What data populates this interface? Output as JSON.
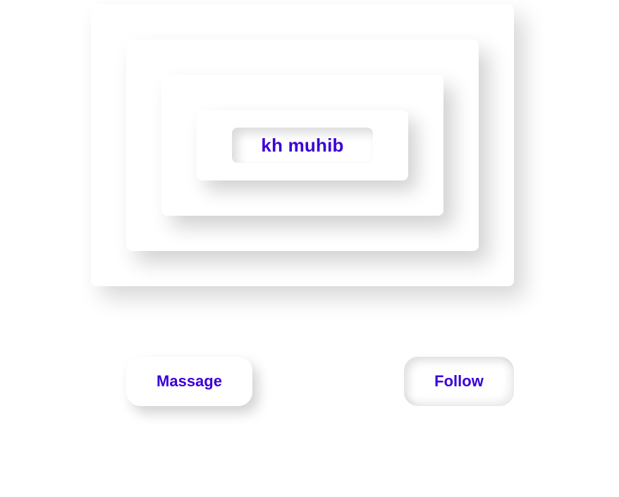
{
  "profile": {
    "name": "kh muhib"
  },
  "actions": {
    "message_label": "Massage",
    "follow_label": "Follow"
  },
  "colors": {
    "accent": "#3a00d6",
    "background": "#ffffff"
  }
}
